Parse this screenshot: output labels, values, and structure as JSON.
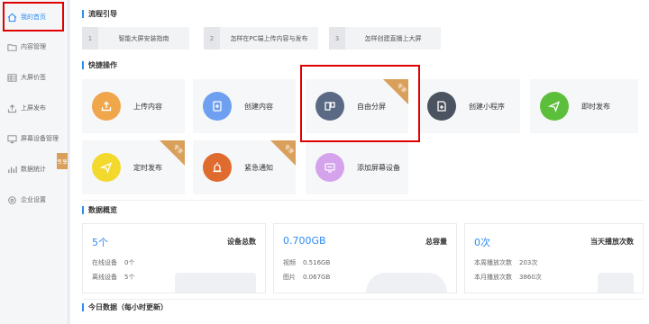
{
  "sidebar": {
    "items": [
      {
        "label": "我的首页",
        "icon": "home-icon"
      },
      {
        "label": "内容管理",
        "icon": "folder-icon"
      },
      {
        "label": "大屏价签",
        "icon": "table-icon"
      },
      {
        "label": "上屏发布",
        "icon": "upload-icon"
      },
      {
        "label": "屏幕设备管理",
        "icon": "monitor-icon"
      },
      {
        "label": "数据统计",
        "icon": "bar-chart-icon"
      },
      {
        "label": "企业设置",
        "icon": "gear-icon"
      }
    ],
    "ribbon": "专享"
  },
  "process": {
    "title": "流程引导",
    "steps": [
      {
        "num": "1",
        "label": "智能大屏安装指南"
      },
      {
        "num": "2",
        "label": "怎样在PC端上传内容与发布"
      },
      {
        "num": "3",
        "label": "怎样创建直播上大屏"
      }
    ]
  },
  "quick": {
    "title": "快捷操作",
    "cards": [
      {
        "label": "上传内容",
        "icon": "upload-icon",
        "color": "#f0a64a"
      },
      {
        "label": "创建内容",
        "icon": "add-doc-icon",
        "color": "#6f9ff0"
      },
      {
        "label": "自由分屏",
        "icon": "split-screen-icon",
        "color": "#5a6a84",
        "badge": "专享"
      },
      {
        "label": "创建小程序",
        "icon": "add-page-icon",
        "color": "#4b5360"
      },
      {
        "label": "即时发布",
        "icon": "send-icon",
        "color": "#5cbf3c"
      },
      {
        "label": "定时发布",
        "icon": "send-icon",
        "color": "#f3d92e",
        "badge": "专享"
      },
      {
        "label": "紧急通知",
        "icon": "alarm-icon",
        "color": "#e06b2f",
        "badge": "专享"
      },
      {
        "label": "添加屏幕设备",
        "icon": "screen-add-icon",
        "color": "#d4a3ec"
      }
    ]
  },
  "overview": {
    "title": "数据概览",
    "stats": [
      {
        "value": "5个",
        "title": "设备总数",
        "rows": [
          {
            "k": "在线设备",
            "v": "0个"
          },
          {
            "k": "离线设备",
            "v": "5个"
          }
        ]
      },
      {
        "value": "0.700GB",
        "title": "总容量",
        "rows": [
          {
            "k": "视频",
            "v": "0.516GB"
          },
          {
            "k": "图片",
            "v": "0.067GB"
          }
        ]
      },
      {
        "value": "0次",
        "title": "当天播放次数",
        "rows": [
          {
            "k": "本周播放次数",
            "v": "203次"
          },
          {
            "k": "本月播放次数",
            "v": "3860次"
          }
        ]
      }
    ]
  },
  "today": {
    "title": "今日数据（每小时更新）"
  },
  "colors": {
    "accent": "#2d8cf0",
    "highlight": "#e00000",
    "badge": "#d9a05b"
  }
}
